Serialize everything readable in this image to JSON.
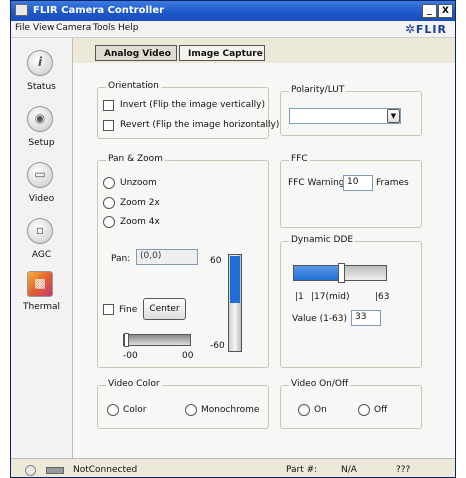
{
  "window": {
    "title": "FLIR Camera Controller",
    "minimize": "_",
    "close": "X"
  },
  "menu": [
    "File",
    "View",
    "Camera",
    "Tools",
    "Help"
  ],
  "logo": "FLIR",
  "sidebar": [
    {
      "label": "Status",
      "icon": "info-icon",
      "glyph": "i"
    },
    {
      "label": "Setup",
      "icon": "lens-icon",
      "glyph": "◉"
    },
    {
      "label": "Video",
      "icon": "monitor-icon",
      "glyph": "▭"
    },
    {
      "label": "AGC",
      "icon": "agc-icon",
      "glyph": "▫"
    },
    {
      "label": "Thermal",
      "icon": "thermal-icon",
      "glyph": "▩"
    }
  ],
  "tabs": [
    {
      "label": "Analog Video",
      "active": true
    },
    {
      "label": "Image Capture",
      "active": false
    }
  ],
  "orientation": {
    "title": "Orientation",
    "invert": "Invert (Flip the image vertically)",
    "revert": "Revert (Flip the image horizontally)",
    "invert_checked": false,
    "revert_checked": false
  },
  "polarity": {
    "title": "Polarity/LUT",
    "value": ""
  },
  "pan_zoom": {
    "title": "Pan & Zoom",
    "options": [
      "Unzoom",
      "Zoom 2x",
      "Zoom 4x"
    ],
    "pan_label": "Pan:",
    "pan_value": "(0,0)",
    "fine_label": "Fine",
    "center_label": "Center",
    "v_top": "60",
    "v_bottom": "-60",
    "h_left": "-00",
    "h_right": "00",
    "v_level": 0.5,
    "h_level": 0.0
  },
  "ffc": {
    "title": "FFC",
    "warning_label": "FFC Warning:",
    "warning_value": "10",
    "units": "Frames"
  },
  "dde": {
    "title": "Dynamic DDE",
    "min": "|1",
    "mid": "|17(mid)",
    "max": "|63",
    "value_label": "Value (1-63)",
    "value": "33",
    "level": 0.516
  },
  "video_color": {
    "title": "Video Color",
    "color": "Color",
    "mono": "Monochrome"
  },
  "video_onoff": {
    "title": "Video On/Off",
    "on": "On",
    "off": "Off"
  },
  "status_bar": {
    "connection": "NotConnected",
    "part_label": "Part #:",
    "part_value": "N/A",
    "unknown": "???"
  },
  "colors": {
    "title_bar": "#1d56c9",
    "slider_fill": "#1f6fd6",
    "panel_bg": "#f7f7f5"
  }
}
